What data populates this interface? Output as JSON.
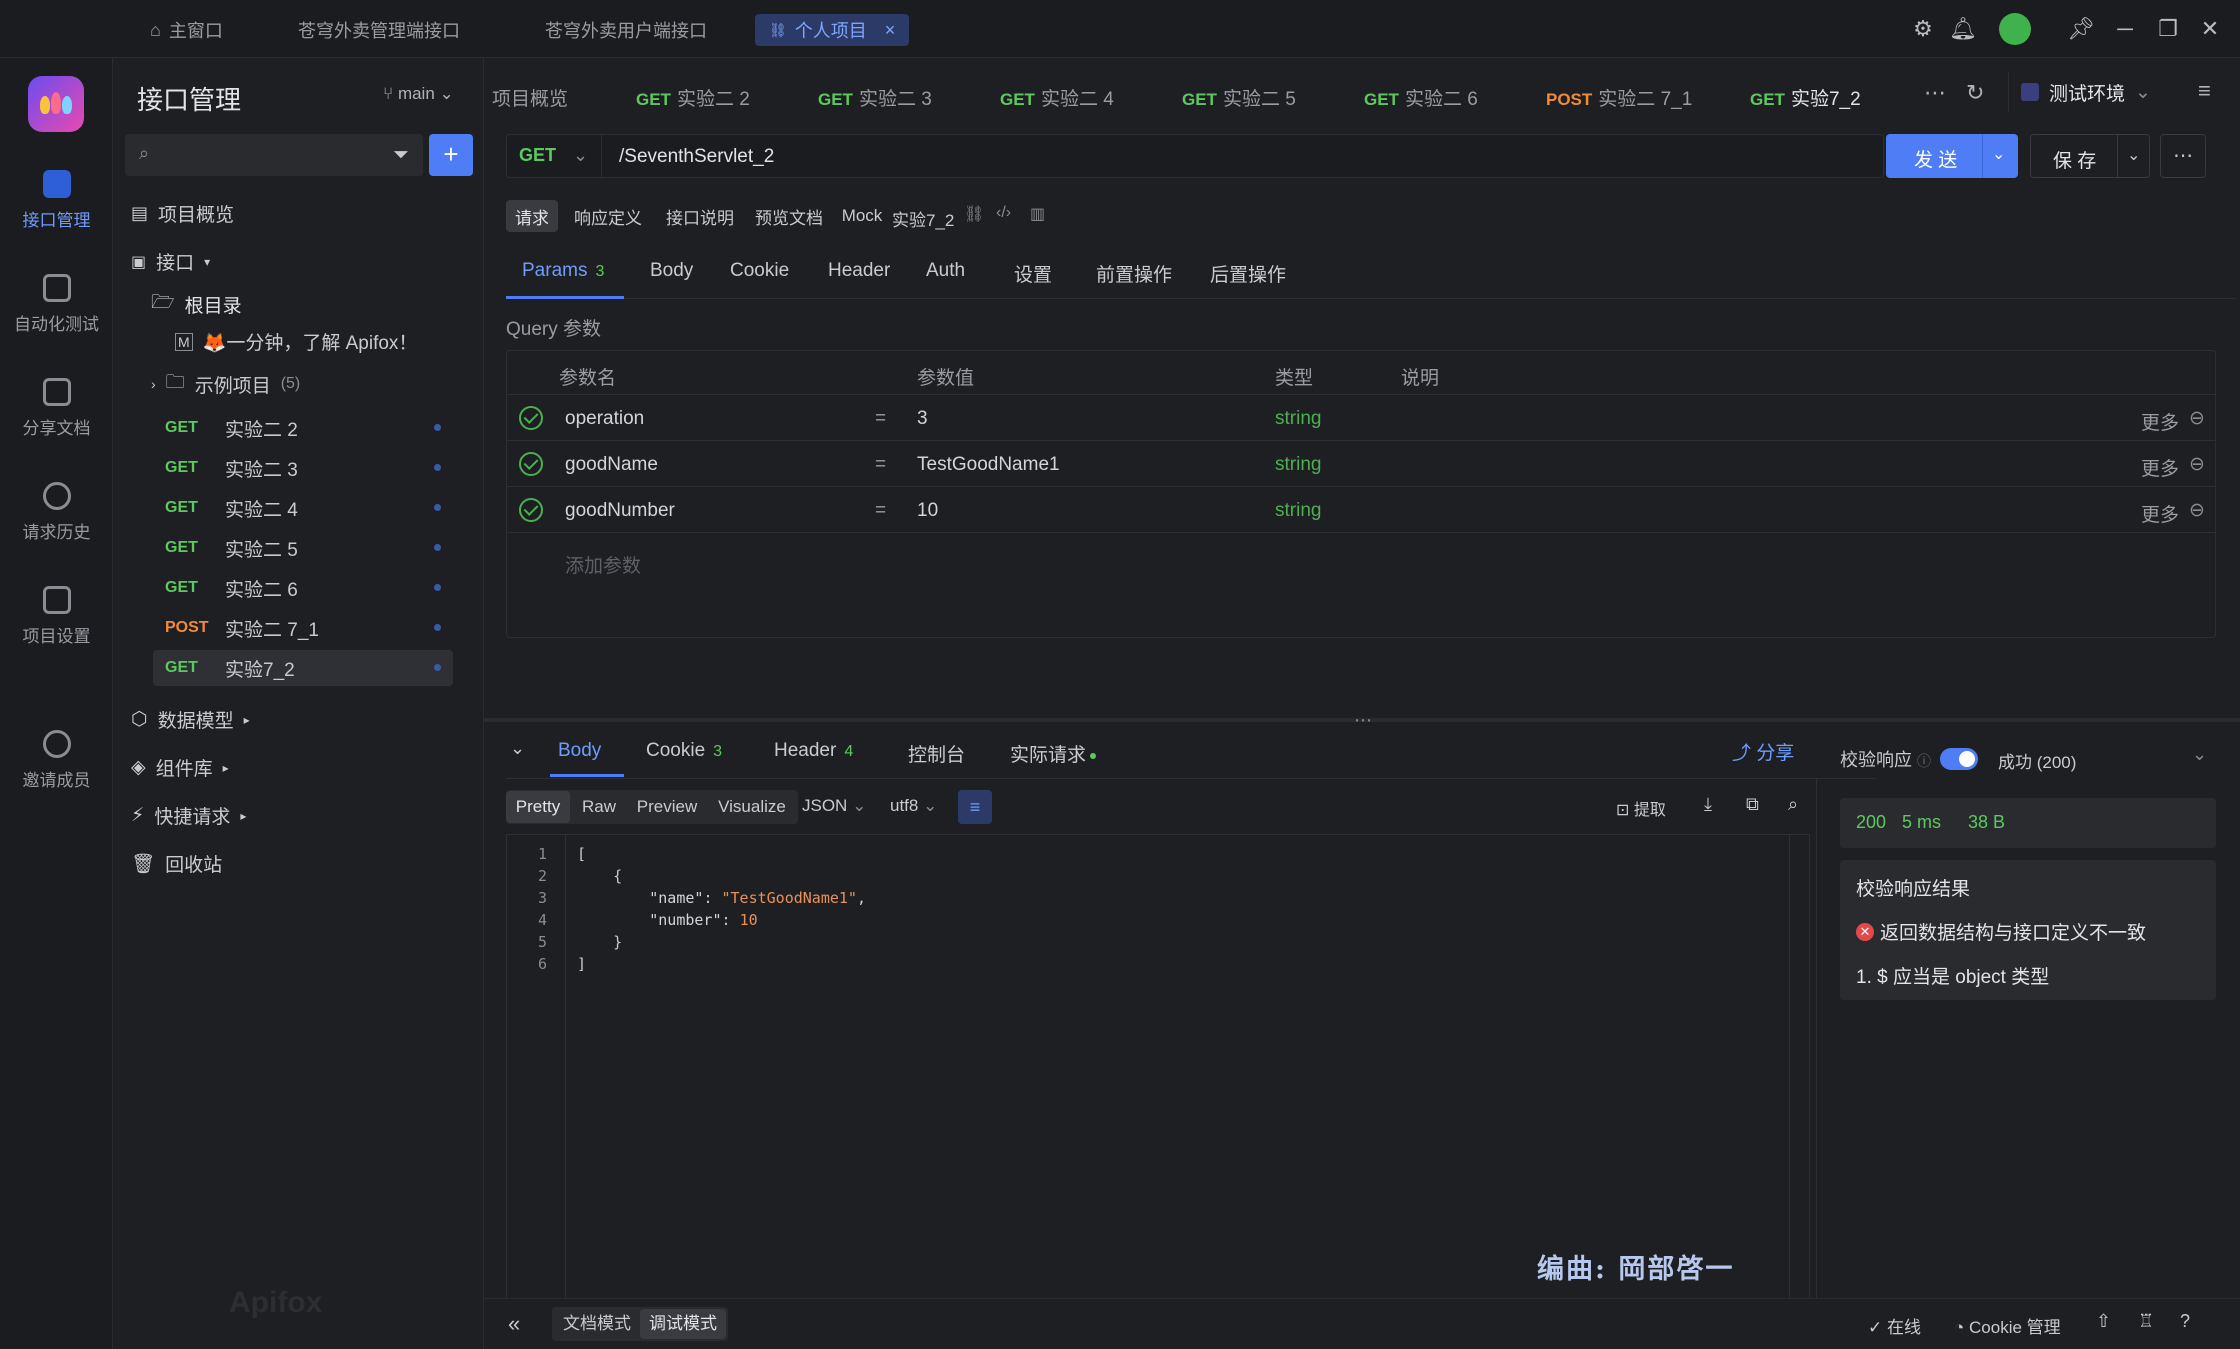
{
  "window_tabs": [
    {
      "label": "主窗口",
      "icon": "home-icon"
    },
    {
      "label": "苍穹外卖管理端接口"
    },
    {
      "label": "苍穹外卖用户端接口"
    },
    {
      "label": "个人项目",
      "active": true
    }
  ],
  "rail": {
    "items": [
      {
        "label": "接口管理",
        "icon": "api-management-icon",
        "active": true
      },
      {
        "label": "自动化测试",
        "icon": "automation-icon"
      },
      {
        "label": "分享文档",
        "icon": "share-doc-icon"
      },
      {
        "label": "请求历史",
        "icon": "history-icon"
      },
      {
        "label": "项目设置",
        "icon": "project-settings-icon"
      },
      {
        "label": "邀请成员",
        "icon": "invite-member-icon"
      }
    ]
  },
  "sidebar": {
    "title": "接口管理",
    "branch": "main",
    "overview": "项目概览",
    "api_group": "接口",
    "root": "根目录",
    "intro_doc": "🦊一分钟，了解 Apifox！",
    "example": "示例项目",
    "example_count": "(5)",
    "endpoints": [
      {
        "method": "GET",
        "name": "实验二 2"
      },
      {
        "method": "GET",
        "name": "实验二 3"
      },
      {
        "method": "GET",
        "name": "实验二 4"
      },
      {
        "method": "GET",
        "name": "实验二 5"
      },
      {
        "method": "GET",
        "name": "实验二 6"
      },
      {
        "method": "POST",
        "name": "实验二 7_1"
      },
      {
        "method": "GET",
        "name": "实验7_2",
        "selected": true
      }
    ],
    "data_model": "数据模型",
    "components": "组件库",
    "quick_request": "快捷请求",
    "recycle": "回收站",
    "watermark": "Apifox"
  },
  "request_tabs": [
    {
      "method": "",
      "name": "项目概览"
    },
    {
      "method": "GET",
      "name": "实验二 2"
    },
    {
      "method": "GET",
      "name": "实验二 3"
    },
    {
      "method": "GET",
      "name": "实验二 4"
    },
    {
      "method": "GET",
      "name": "实验二 5"
    },
    {
      "method": "GET",
      "name": "实验二 6"
    },
    {
      "method": "POST",
      "name": "实验二 7_1"
    },
    {
      "method": "GET",
      "name": "实验7_2",
      "active": true
    }
  ],
  "env": "测试环境",
  "request": {
    "method": "GET",
    "url": "/SeventhServlet_2",
    "send": "发 送",
    "save": "保 存"
  },
  "doc_tabs": [
    "请求",
    "响应定义",
    "接口说明",
    "预览文档",
    "Mock"
  ],
  "doc_name": "实验7_2",
  "param_tabs": [
    {
      "label": "Params",
      "count": "3",
      "active": true
    },
    {
      "label": "Body"
    },
    {
      "label": "Cookie"
    },
    {
      "label": "Header"
    },
    {
      "label": "Auth"
    },
    {
      "label": "设置"
    },
    {
      "label": "前置操作"
    },
    {
      "label": "后置操作"
    }
  ],
  "query": {
    "title": "Query 参数",
    "headers": [
      "参数名",
      "参数值",
      "类型",
      "说明"
    ],
    "rows": [
      {
        "name": "operation",
        "value": "3",
        "type": "string",
        "more": "更多"
      },
      {
        "name": "goodName",
        "value": "TestGoodName1",
        "type": "string",
        "more": "更多"
      },
      {
        "name": "goodNumber",
        "value": "10",
        "type": "string",
        "more": "更多"
      }
    ],
    "add": "添加参数"
  },
  "response": {
    "tabs": [
      {
        "label": "Body",
        "active": true
      },
      {
        "label": "Cookie",
        "count": "3"
      },
      {
        "label": "Header",
        "count": "4"
      },
      {
        "label": "控制台"
      },
      {
        "label": "实际请求"
      }
    ],
    "share": "分享",
    "formats": [
      "Pretty",
      "Raw",
      "Preview",
      "Visualize"
    ],
    "lang": "JSON",
    "encoding": "utf8",
    "extract": "提取",
    "lines": [
      {
        "n": "1",
        "text": "["
      },
      {
        "n": "2",
        "text": "    {"
      },
      {
        "n": "3",
        "key": "\"name\"",
        "val": "\"TestGoodName1\"",
        "tail": ","
      },
      {
        "n": "4",
        "key": "\"number\"",
        "val": "10",
        "tail": ""
      },
      {
        "n": "5",
        "text": "    }"
      },
      {
        "n": "6",
        "text": "]"
      }
    ],
    "overlay_text": "编曲: 岡部啓一"
  },
  "validation": {
    "label": "校验响应",
    "status": "成功 (200)",
    "code": "200",
    "time": "5 ms",
    "size": "38 B",
    "result_title": "校验响应结果",
    "error": "返回数据结构与接口定义不一致",
    "detail": "1. $ 应当是 object 类型"
  },
  "footer": {
    "doc_mode": "文档模式",
    "debug_mode": "调试模式",
    "online": "在线",
    "cookie": "Cookie 管理"
  },
  "colors": {
    "accent": "#4f7df5",
    "get": "#5cc95f",
    "post": "#f08b3a",
    "error": "#e54848"
  }
}
